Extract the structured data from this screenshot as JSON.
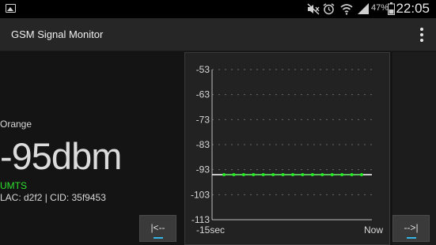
{
  "status_bar": {
    "battery_percent": "47%",
    "clock": "22:05",
    "icons": [
      "gallery-icon",
      "mute-icon",
      "alarm-icon",
      "wifi-icon",
      "signal-icon",
      "battery-icon"
    ]
  },
  "action_bar": {
    "title": "GSM Signal Monitor",
    "menu_icon": "overflow-menu-icon"
  },
  "info": {
    "operator": "Orange",
    "signal": "-95dbm",
    "network_type": "UMTS",
    "cell": "LAC: d2f2 | CID: 35f9453"
  },
  "buttons": {
    "back_label": "|<--",
    "forward_label": "-->|"
  },
  "colors": {
    "accent": "#33b5e5",
    "network": "#2ee02e",
    "series": "#22ee22"
  },
  "chart_data": {
    "type": "line",
    "x_start_label": "-15sec",
    "x_end_label": "Now",
    "y_ticks": [
      -53,
      -63,
      -73,
      -83,
      -93,
      -103,
      -113
    ],
    "ylim": [
      -113,
      -53
    ],
    "grid": true,
    "series": [
      {
        "values": [
          -95,
          -95,
          -95,
          -95,
          -95,
          -95,
          -95,
          -95,
          -95,
          -95,
          -95,
          -95,
          -95,
          -95,
          -95
        ]
      }
    ]
  }
}
